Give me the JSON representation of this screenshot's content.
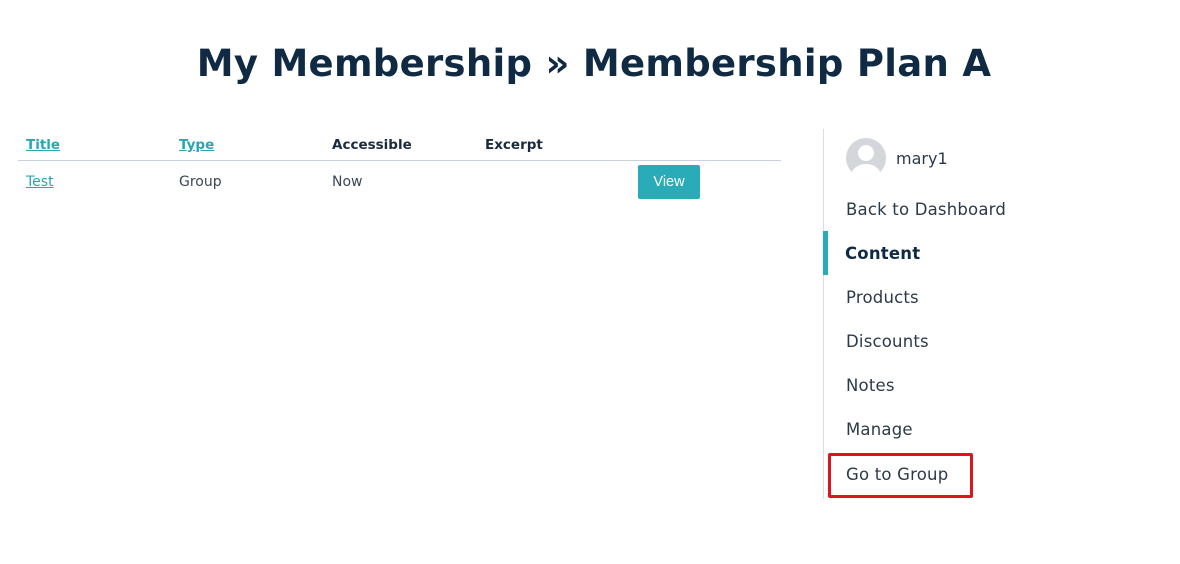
{
  "page": {
    "title": "My Membership » Membership Plan A"
  },
  "table": {
    "headers": {
      "title": "Title",
      "type": "Type",
      "accessible": "Accessible",
      "excerpt": "Excerpt"
    },
    "rows": [
      {
        "title": "Test",
        "type": "Group",
        "accessible": "Now",
        "excerpt": "",
        "action_label": "View"
      }
    ]
  },
  "sidebar": {
    "username": "mary1",
    "items": [
      {
        "label": "Back to Dashboard",
        "active": false
      },
      {
        "label": "Content",
        "active": true
      },
      {
        "label": "Products",
        "active": false
      },
      {
        "label": "Discounts",
        "active": false
      },
      {
        "label": "Notes",
        "active": false
      },
      {
        "label": "Manage",
        "active": false
      },
      {
        "label": "Go to Group",
        "active": false,
        "highlighted": true
      }
    ]
  },
  "colors": {
    "accent": "#2aacb8",
    "highlight": "#e0141e",
    "heading": "#102a43"
  }
}
